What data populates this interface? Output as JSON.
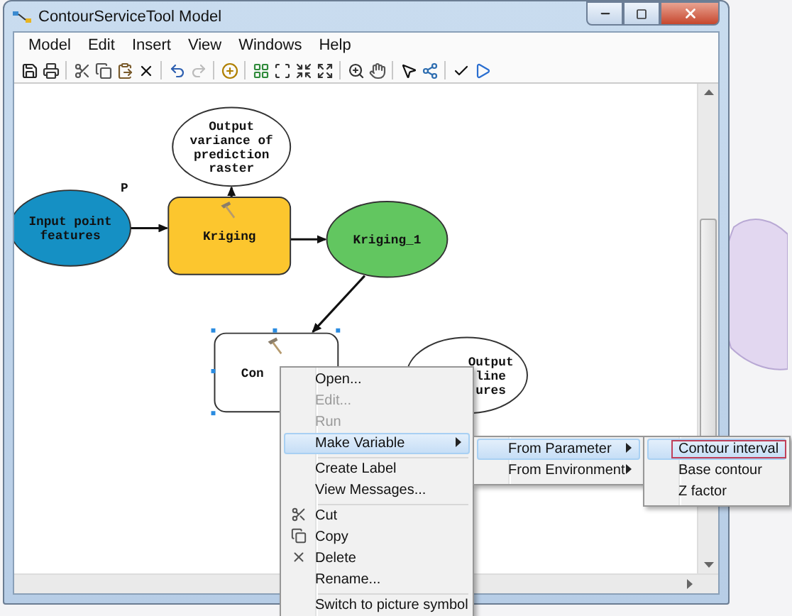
{
  "window": {
    "title": "ContourServiceTool Model"
  },
  "menu_bar": [
    "Model",
    "Edit",
    "Insert",
    "View",
    "Windows",
    "Help"
  ],
  "diagram": {
    "nodes": [
      {
        "kind": "ellipse",
        "lines": [
          "Output",
          "variance of",
          "prediction",
          "raster"
        ]
      },
      {
        "kind": "ellipse",
        "lines": [
          "Input point",
          "features"
        ],
        "color": "#1590c4"
      },
      {
        "kind": "tool",
        "lines": [
          "Kriging"
        ],
        "color": "#fcc62e"
      },
      {
        "kind": "ellipse",
        "lines": [
          "Kriging_1"
        ],
        "color": "#62c660"
      },
      {
        "kind": "tool",
        "lines": [
          "Con"
        ],
        "selected": true
      },
      {
        "kind": "ellipse",
        "lines": [
          "Output",
          "line",
          "ures"
        ]
      }
    ],
    "marker": "P"
  },
  "context_menu": {
    "items": [
      {
        "label": "Open...",
        "disabled": false,
        "selected": false,
        "has_submenu": false,
        "separator_before": false
      },
      {
        "label": "Edit...",
        "disabled": true,
        "selected": false,
        "has_submenu": false,
        "separator_before": false
      },
      {
        "label": "Run",
        "disabled": true,
        "selected": false,
        "has_submenu": false,
        "separator_before": false
      },
      {
        "label": "Make Variable",
        "disabled": false,
        "selected": true,
        "has_submenu": true,
        "separator_before": false
      },
      {
        "label": "Create Label",
        "disabled": false,
        "selected": false,
        "has_submenu": false,
        "separator_before": true
      },
      {
        "label": "View Messages...",
        "disabled": false,
        "selected": false,
        "has_submenu": false,
        "separator_before": false
      },
      {
        "label": "Cut",
        "disabled": false,
        "selected": false,
        "has_submenu": false,
        "separator_before": true
      },
      {
        "label": "Copy",
        "disabled": false,
        "selected": false,
        "has_submenu": false,
        "separator_before": false
      },
      {
        "label": "Delete",
        "disabled": false,
        "selected": false,
        "has_submenu": false,
        "separator_before": false
      },
      {
        "label": "Rename...",
        "disabled": false,
        "selected": false,
        "has_submenu": false,
        "separator_before": false
      },
      {
        "label": "Switch to picture symbol",
        "disabled": false,
        "selected": false,
        "has_submenu": false,
        "separator_before": true
      }
    ]
  },
  "variable_submenu": {
    "items": [
      {
        "label": "From Parameter",
        "selected": true,
        "has_submenu": true
      },
      {
        "label": "From Environment",
        "selected": false,
        "has_submenu": true
      }
    ]
  },
  "parameter_submenu": {
    "items": [
      {
        "label": "Contour interval",
        "selected": true
      },
      {
        "label": "Base contour",
        "selected": false
      },
      {
        "label": "Z factor",
        "selected": false
      }
    ]
  }
}
